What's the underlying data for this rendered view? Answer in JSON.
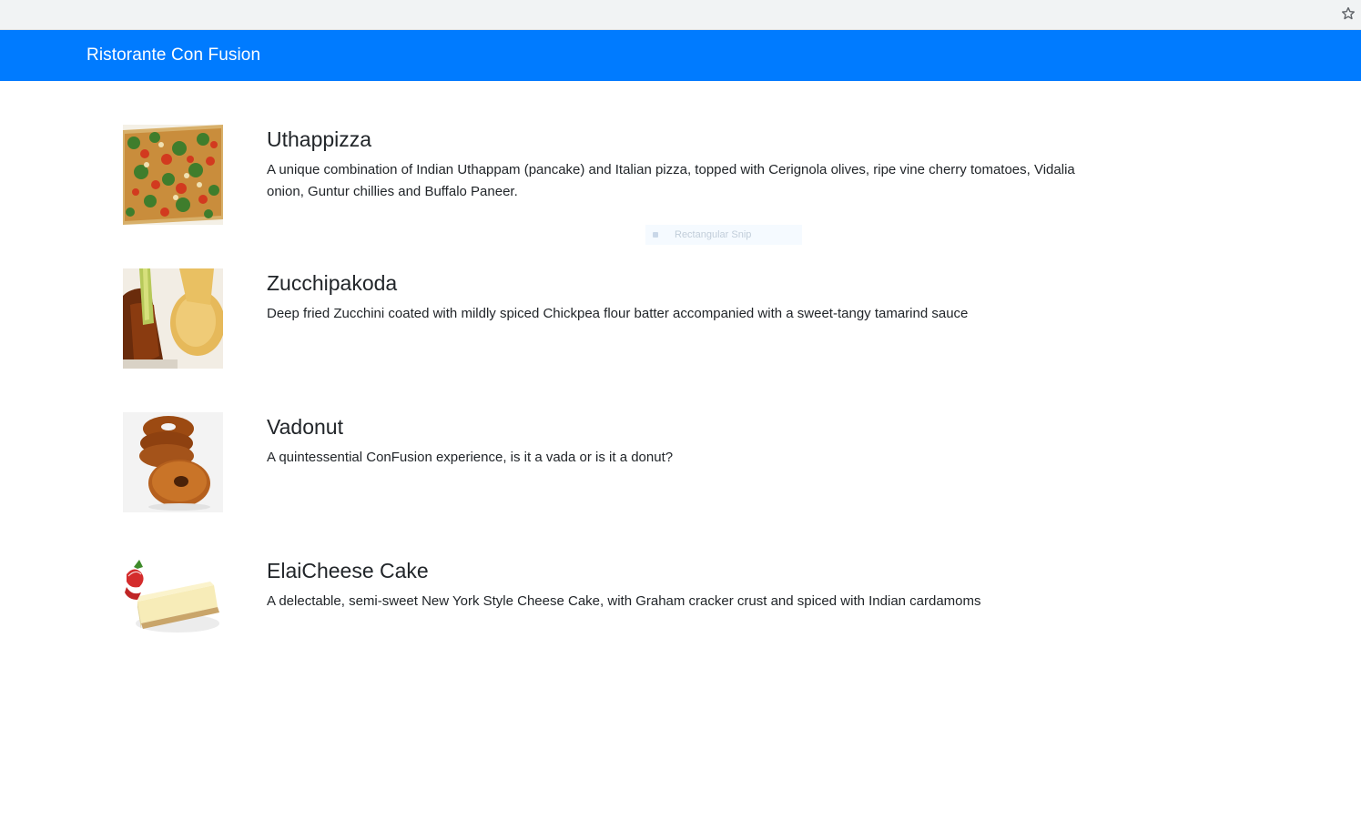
{
  "browser": {
    "bookmark_icon": "star-outline-icon"
  },
  "navbar": {
    "brand": "Ristorante Con Fusion",
    "color": "#007bff"
  },
  "snip_overlay": {
    "label": "Rectangular Snip"
  },
  "dishes": [
    {
      "name": "Uthappizza",
      "description": "A unique combination of Indian Uthappam (pancake) and Italian pizza, topped with Cerignola olives, ripe vine cherry tomatoes, Vidalia onion, Guntur chillies and Buffalo Paneer.",
      "image": "uthappizza-photo"
    },
    {
      "name": "Zucchipakoda",
      "description": "Deep fried Zucchini coated with mildly spiced Chickpea flour batter accompanied with a sweet-tangy tamarind sauce",
      "image": "zucchipakoda-photo"
    },
    {
      "name": "Vadonut",
      "description": "A quintessential ConFusion experience, is it a vada or is it a donut?",
      "image": "vadonut-photo"
    },
    {
      "name": "ElaiCheese Cake",
      "description": "A delectable, semi-sweet New York Style Cheese Cake, with Graham cracker crust and spiced with Indian cardamoms",
      "image": "elaicheese-cake-photo"
    }
  ]
}
